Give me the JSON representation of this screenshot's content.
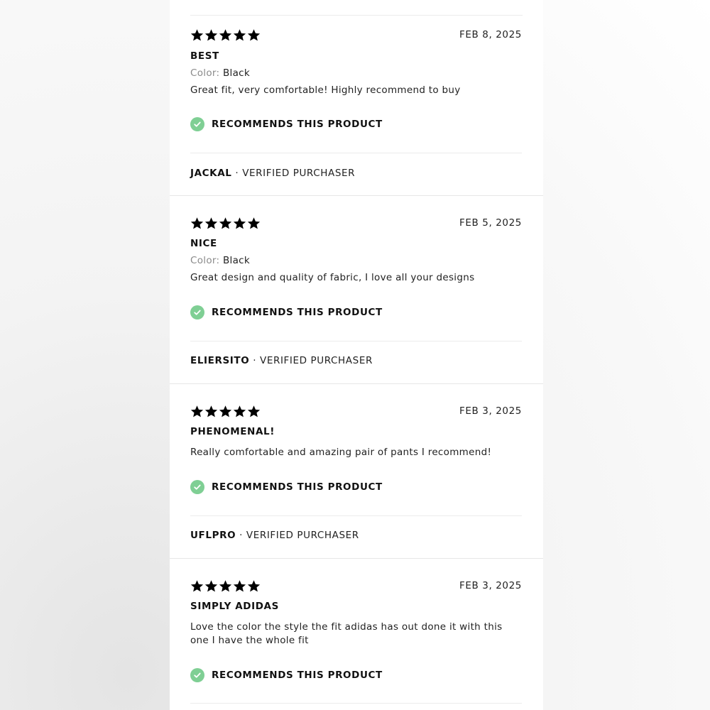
{
  "rating_max": 5,
  "recommend_label": "RECOMMENDS THIS PRODUCT",
  "color_label": "Color:",
  "author_separator": "·",
  "verified_label": "VERIFIED PURCHASER",
  "reviews": [
    {
      "rating": 5,
      "date": "FEB 8, 2025",
      "title": "BEST",
      "color": "Black",
      "body": "Great fit, very comfortable! Highly recommend to buy",
      "author": "JACKAL"
    },
    {
      "rating": 5,
      "date": "FEB 5, 2025",
      "title": "NICE",
      "color": "Black",
      "body": "Great design and quality of fabric, I love all your designs",
      "author": "ELIERSITO"
    },
    {
      "rating": 5,
      "date": "FEB 3, 2025",
      "title": "PHENOMENAL!",
      "body": "Really comfortable and amazing pair of pants I recommend!",
      "author": "UFLPRO"
    },
    {
      "rating": 5,
      "date": "FEB 3, 2025",
      "title": "SIMPLY ADIDAS",
      "body": "Love the color the style the fit adidas has out done it with this one I have the whole fit",
      "author": ""
    }
  ],
  "colors": {
    "check_green": "#7fcf94",
    "star": "#000000"
  },
  "icons": {
    "star": "star-icon",
    "check": "checkmark-icon"
  }
}
